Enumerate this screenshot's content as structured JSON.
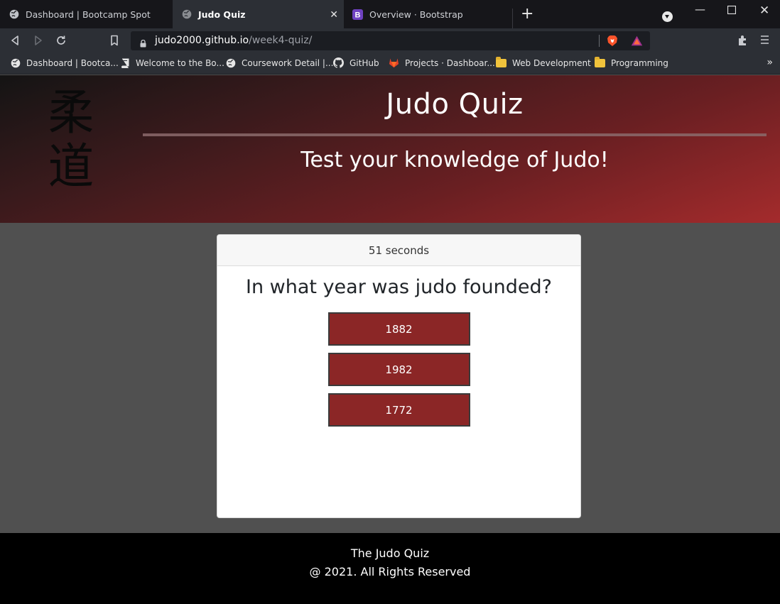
{
  "browser": {
    "tabs": [
      {
        "title": "Dashboard | Bootcamp Spot",
        "icon": "globe-icon",
        "active": false
      },
      {
        "title": "Judo Quiz",
        "icon": "globe-icon",
        "active": true
      },
      {
        "title": "Overview · Bootstrap",
        "icon": "bootstrap-icon",
        "active": false
      }
    ],
    "new_tab_label": "+",
    "url": {
      "host": "judo2000.github.io",
      "path": "/week4-quiz/"
    },
    "bookmarks": [
      {
        "label": "Dashboard | Bootca...",
        "icon": "globe-icon"
      },
      {
        "label": "Welcome to the Bo...",
        "icon": "book-icon"
      },
      {
        "label": "Coursework Detail |...",
        "icon": "globe-icon"
      },
      {
        "label": "GitHub",
        "icon": "github-icon"
      },
      {
        "label": "Projects · Dashboar...",
        "icon": "gitlab-icon"
      },
      {
        "label": "Web Development",
        "icon": "folder-icon"
      },
      {
        "label": "Programming",
        "icon": "folder-icon"
      }
    ],
    "bookmarks_overflow": "»"
  },
  "header": {
    "kanji": "柔道",
    "title": "Judo Quiz",
    "subtitle": "Test your knowledge of Judo!"
  },
  "quiz": {
    "timer": "51 seconds",
    "question": "In what year was judo founded?",
    "answers": [
      "1882",
      "1982",
      "1772"
    ]
  },
  "footer": {
    "line1": "The Judo Quiz",
    "line2": "@ 2021. All Rights Reserved"
  },
  "colors": {
    "accent": "#8b2626",
    "page_bg": "#505050",
    "footer_bg": "#000000"
  }
}
